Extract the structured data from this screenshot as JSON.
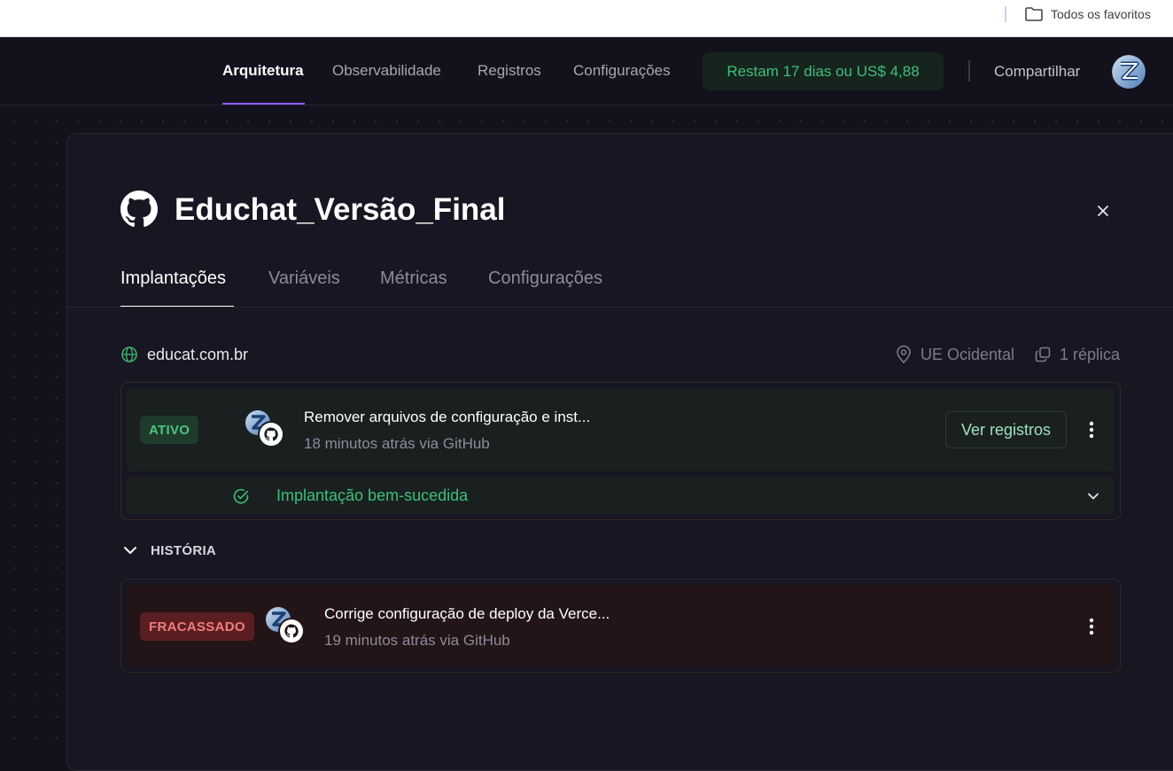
{
  "bookmarks_bar": {
    "label": "Todos os favoritos",
    "icon": "folder-icon"
  },
  "header": {
    "nav": [
      {
        "label": "Arquitetura",
        "active": true
      },
      {
        "label": "Observabilidade",
        "active": false
      },
      {
        "label": "Registros",
        "active": false
      },
      {
        "label": "Configurações",
        "active": false
      }
    ],
    "trial": "Restam 17 dias ou US$ 4,88",
    "share": "Compartilhar",
    "avatar_icon": "user-avatar-z"
  },
  "service": {
    "title": "Educhat_Versão_Final",
    "icon": "github-icon",
    "tabs": [
      {
        "label": "Implantações",
        "active": true
      },
      {
        "label": "Variáveis",
        "active": false
      },
      {
        "label": "Métricas",
        "active": false
      },
      {
        "label": "Configurações",
        "active": false
      }
    ],
    "domain": "educat.com.br",
    "region": "UE Ocidental",
    "replicas": "1 réplica"
  },
  "active_deployment": {
    "status": "ATIVO",
    "commit": "Remover arquivos de configuração e inst...",
    "meta": "18 minutos atrás via GitHub",
    "view_logs": "Ver registros",
    "result": "Implantação bem-sucedida"
  },
  "history": {
    "label": "HISTÓRIA",
    "items": [
      {
        "status": "FRACASSADO",
        "commit": "Corrige configuração de deploy da Verce...",
        "meta": "19 minutos atrás via GitHub"
      }
    ]
  },
  "colors": {
    "accent": "#8b5cf6",
    "success": "#4cc57f",
    "failure": "#f27c7c",
    "background": "#13111c"
  }
}
